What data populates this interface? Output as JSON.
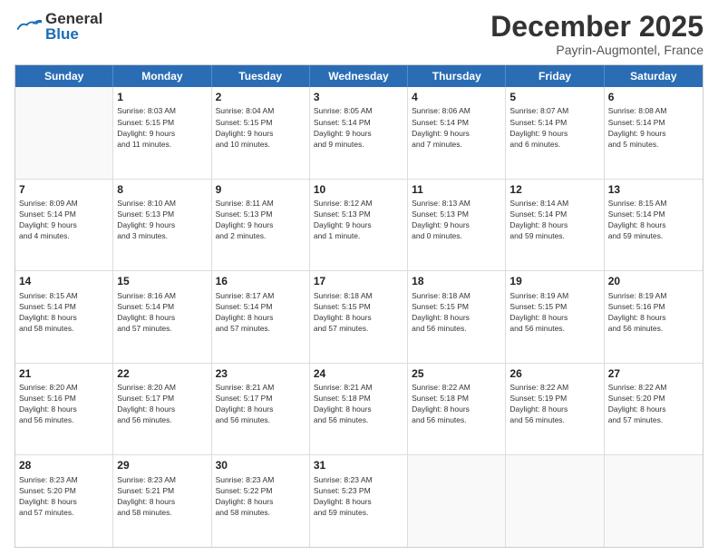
{
  "header": {
    "logo_line1": "General",
    "logo_line2": "Blue",
    "month": "December 2025",
    "location": "Payrin-Augmontel, France"
  },
  "calendar": {
    "days_of_week": [
      "Sunday",
      "Monday",
      "Tuesday",
      "Wednesday",
      "Thursday",
      "Friday",
      "Saturday"
    ],
    "rows": [
      [
        {
          "day": "",
          "text": ""
        },
        {
          "day": "1",
          "text": "Sunrise: 8:03 AM\nSunset: 5:15 PM\nDaylight: 9 hours\nand 11 minutes."
        },
        {
          "day": "2",
          "text": "Sunrise: 8:04 AM\nSunset: 5:15 PM\nDaylight: 9 hours\nand 10 minutes."
        },
        {
          "day": "3",
          "text": "Sunrise: 8:05 AM\nSunset: 5:14 PM\nDaylight: 9 hours\nand 9 minutes."
        },
        {
          "day": "4",
          "text": "Sunrise: 8:06 AM\nSunset: 5:14 PM\nDaylight: 9 hours\nand 7 minutes."
        },
        {
          "day": "5",
          "text": "Sunrise: 8:07 AM\nSunset: 5:14 PM\nDaylight: 9 hours\nand 6 minutes."
        },
        {
          "day": "6",
          "text": "Sunrise: 8:08 AM\nSunset: 5:14 PM\nDaylight: 9 hours\nand 5 minutes."
        }
      ],
      [
        {
          "day": "7",
          "text": "Sunrise: 8:09 AM\nSunset: 5:14 PM\nDaylight: 9 hours\nand 4 minutes."
        },
        {
          "day": "8",
          "text": "Sunrise: 8:10 AM\nSunset: 5:13 PM\nDaylight: 9 hours\nand 3 minutes."
        },
        {
          "day": "9",
          "text": "Sunrise: 8:11 AM\nSunset: 5:13 PM\nDaylight: 9 hours\nand 2 minutes."
        },
        {
          "day": "10",
          "text": "Sunrise: 8:12 AM\nSunset: 5:13 PM\nDaylight: 9 hours\nand 1 minute."
        },
        {
          "day": "11",
          "text": "Sunrise: 8:13 AM\nSunset: 5:13 PM\nDaylight: 9 hours\nand 0 minutes."
        },
        {
          "day": "12",
          "text": "Sunrise: 8:14 AM\nSunset: 5:14 PM\nDaylight: 8 hours\nand 59 minutes."
        },
        {
          "day": "13",
          "text": "Sunrise: 8:15 AM\nSunset: 5:14 PM\nDaylight: 8 hours\nand 59 minutes."
        }
      ],
      [
        {
          "day": "14",
          "text": "Sunrise: 8:15 AM\nSunset: 5:14 PM\nDaylight: 8 hours\nand 58 minutes."
        },
        {
          "day": "15",
          "text": "Sunrise: 8:16 AM\nSunset: 5:14 PM\nDaylight: 8 hours\nand 57 minutes."
        },
        {
          "day": "16",
          "text": "Sunrise: 8:17 AM\nSunset: 5:14 PM\nDaylight: 8 hours\nand 57 minutes."
        },
        {
          "day": "17",
          "text": "Sunrise: 8:18 AM\nSunset: 5:15 PM\nDaylight: 8 hours\nand 57 minutes."
        },
        {
          "day": "18",
          "text": "Sunrise: 8:18 AM\nSunset: 5:15 PM\nDaylight: 8 hours\nand 56 minutes."
        },
        {
          "day": "19",
          "text": "Sunrise: 8:19 AM\nSunset: 5:15 PM\nDaylight: 8 hours\nand 56 minutes."
        },
        {
          "day": "20",
          "text": "Sunrise: 8:19 AM\nSunset: 5:16 PM\nDaylight: 8 hours\nand 56 minutes."
        }
      ],
      [
        {
          "day": "21",
          "text": "Sunrise: 8:20 AM\nSunset: 5:16 PM\nDaylight: 8 hours\nand 56 minutes."
        },
        {
          "day": "22",
          "text": "Sunrise: 8:20 AM\nSunset: 5:17 PM\nDaylight: 8 hours\nand 56 minutes."
        },
        {
          "day": "23",
          "text": "Sunrise: 8:21 AM\nSunset: 5:17 PM\nDaylight: 8 hours\nand 56 minutes."
        },
        {
          "day": "24",
          "text": "Sunrise: 8:21 AM\nSunset: 5:18 PM\nDaylight: 8 hours\nand 56 minutes."
        },
        {
          "day": "25",
          "text": "Sunrise: 8:22 AM\nSunset: 5:18 PM\nDaylight: 8 hours\nand 56 minutes."
        },
        {
          "day": "26",
          "text": "Sunrise: 8:22 AM\nSunset: 5:19 PM\nDaylight: 8 hours\nand 56 minutes."
        },
        {
          "day": "27",
          "text": "Sunrise: 8:22 AM\nSunset: 5:20 PM\nDaylight: 8 hours\nand 57 minutes."
        }
      ],
      [
        {
          "day": "28",
          "text": "Sunrise: 8:23 AM\nSunset: 5:20 PM\nDaylight: 8 hours\nand 57 minutes."
        },
        {
          "day": "29",
          "text": "Sunrise: 8:23 AM\nSunset: 5:21 PM\nDaylight: 8 hours\nand 58 minutes."
        },
        {
          "day": "30",
          "text": "Sunrise: 8:23 AM\nSunset: 5:22 PM\nDaylight: 8 hours\nand 58 minutes."
        },
        {
          "day": "31",
          "text": "Sunrise: 8:23 AM\nSunset: 5:23 PM\nDaylight: 8 hours\nand 59 minutes."
        },
        {
          "day": "",
          "text": ""
        },
        {
          "day": "",
          "text": ""
        },
        {
          "day": "",
          "text": ""
        }
      ]
    ]
  }
}
